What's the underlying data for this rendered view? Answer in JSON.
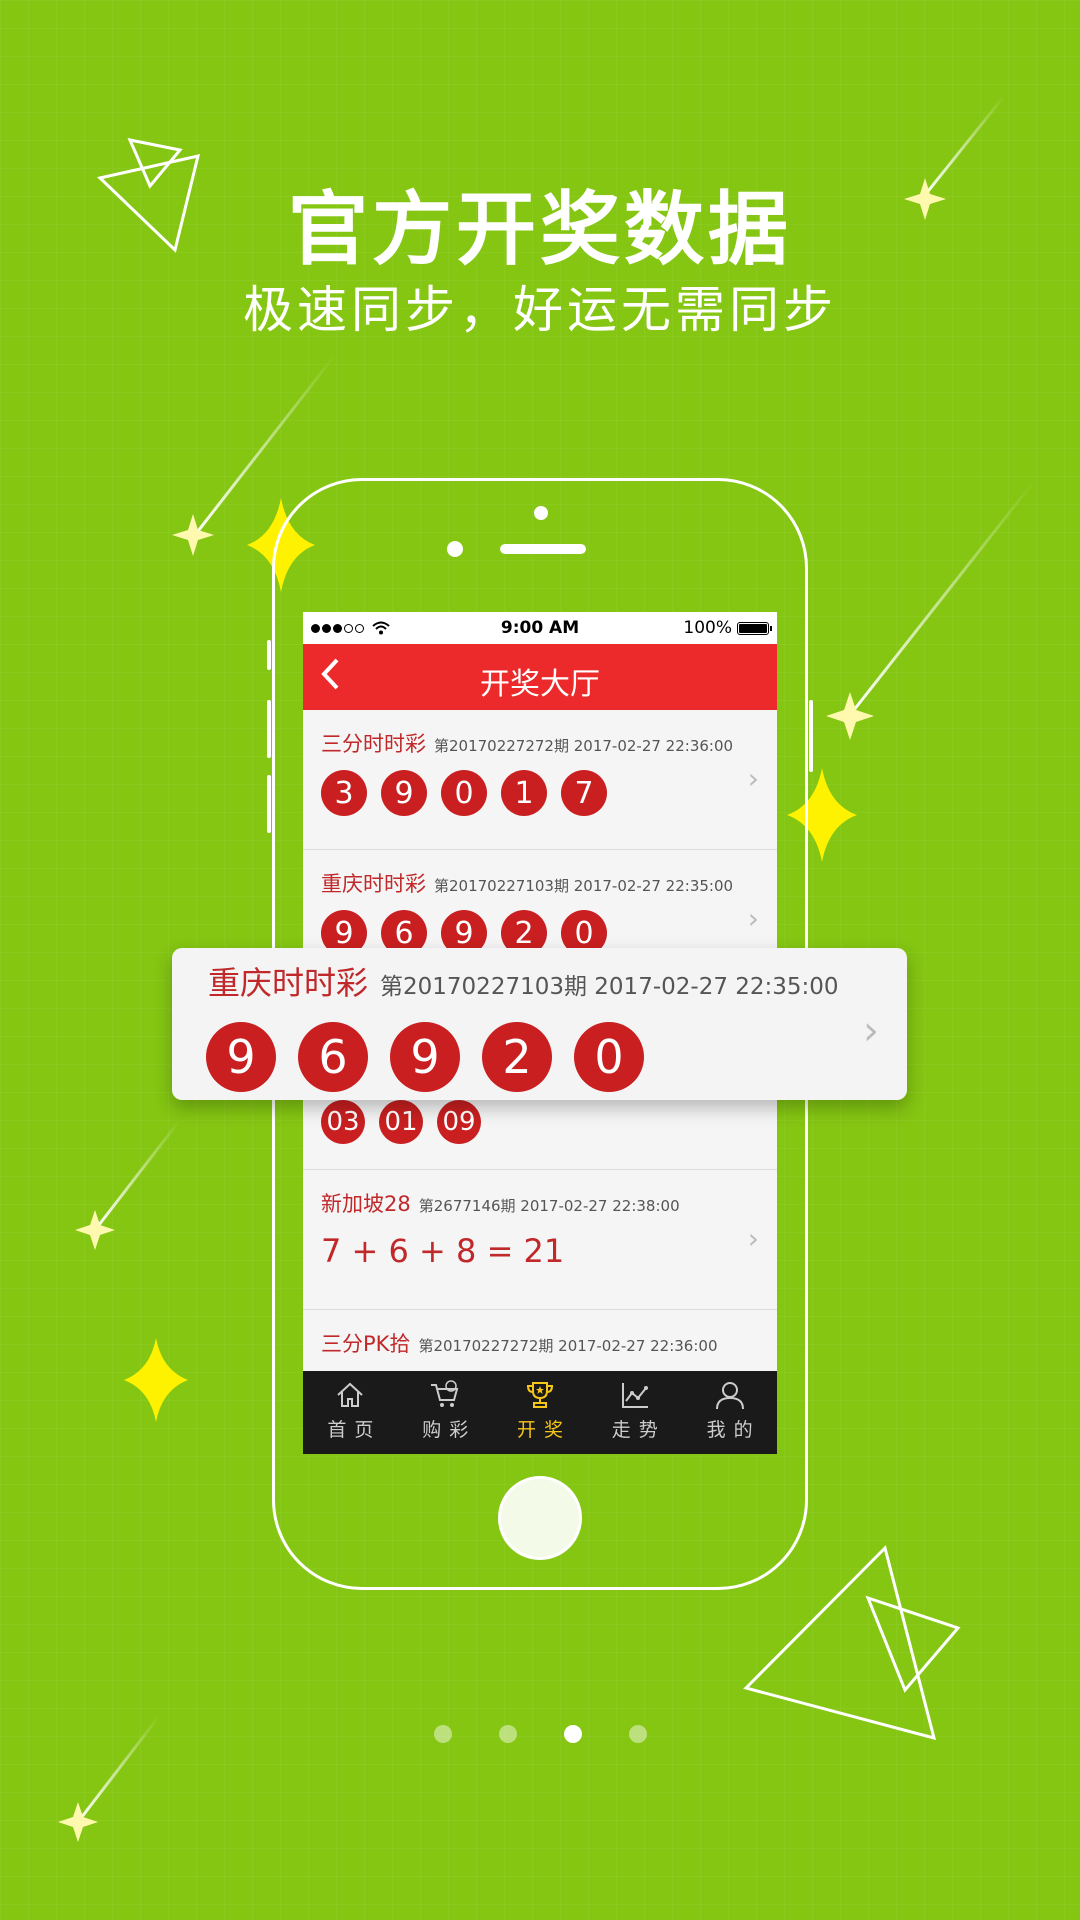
{
  "headline": {
    "title": "官方开奖数据",
    "subtitle": "极速同步，好运无需同步"
  },
  "status_bar": {
    "time": "9:00 AM",
    "battery": "100%"
  },
  "nav": {
    "back_icon": "chevron-left-icon",
    "title": "开奖大厅"
  },
  "results": [
    {
      "name": "三分时时彩",
      "meta": "第20170227272期 2017-02-27 22:36:00",
      "balls": [
        "3",
        "9",
        "0",
        "1",
        "7"
      ]
    },
    {
      "name": "重庆时时彩",
      "meta": "第20170227103期 2017-02-27 22:35:00",
      "balls": [
        "9",
        "6",
        "9",
        "2",
        "0"
      ]
    },
    {
      "name": "",
      "meta": "",
      "balls": [
        "03",
        "01",
        "09"
      ]
    },
    {
      "name": "新加坡28",
      "meta": "第2677146期 2017-02-27 22:38:00",
      "formula": "7 + 6 + 8 = 21"
    },
    {
      "name": "三分PK拾",
      "meta": "第20170227272期 2017-02-27 22:36:00"
    }
  ],
  "highlight": {
    "name": "重庆时时彩",
    "meta": "第20170227103期 2017-02-27 22:35:00",
    "balls": [
      "9",
      "6",
      "9",
      "2",
      "0"
    ]
  },
  "tabs": [
    {
      "label": "首页",
      "icon": "home-icon"
    },
    {
      "label": "购彩",
      "icon": "cart-icon"
    },
    {
      "label": "开奖",
      "icon": "trophy-icon",
      "active": true
    },
    {
      "label": "走势",
      "icon": "chart-icon"
    },
    {
      "label": "我的",
      "icon": "user-icon"
    }
  ],
  "pager": {
    "count": 4,
    "active_index": 2
  },
  "colors": {
    "background": "#84c612",
    "nav_red": "#ec2a2b",
    "ball_red": "#c91f20",
    "tab_active": "#f5c518",
    "star_yellow": "#fff200"
  }
}
